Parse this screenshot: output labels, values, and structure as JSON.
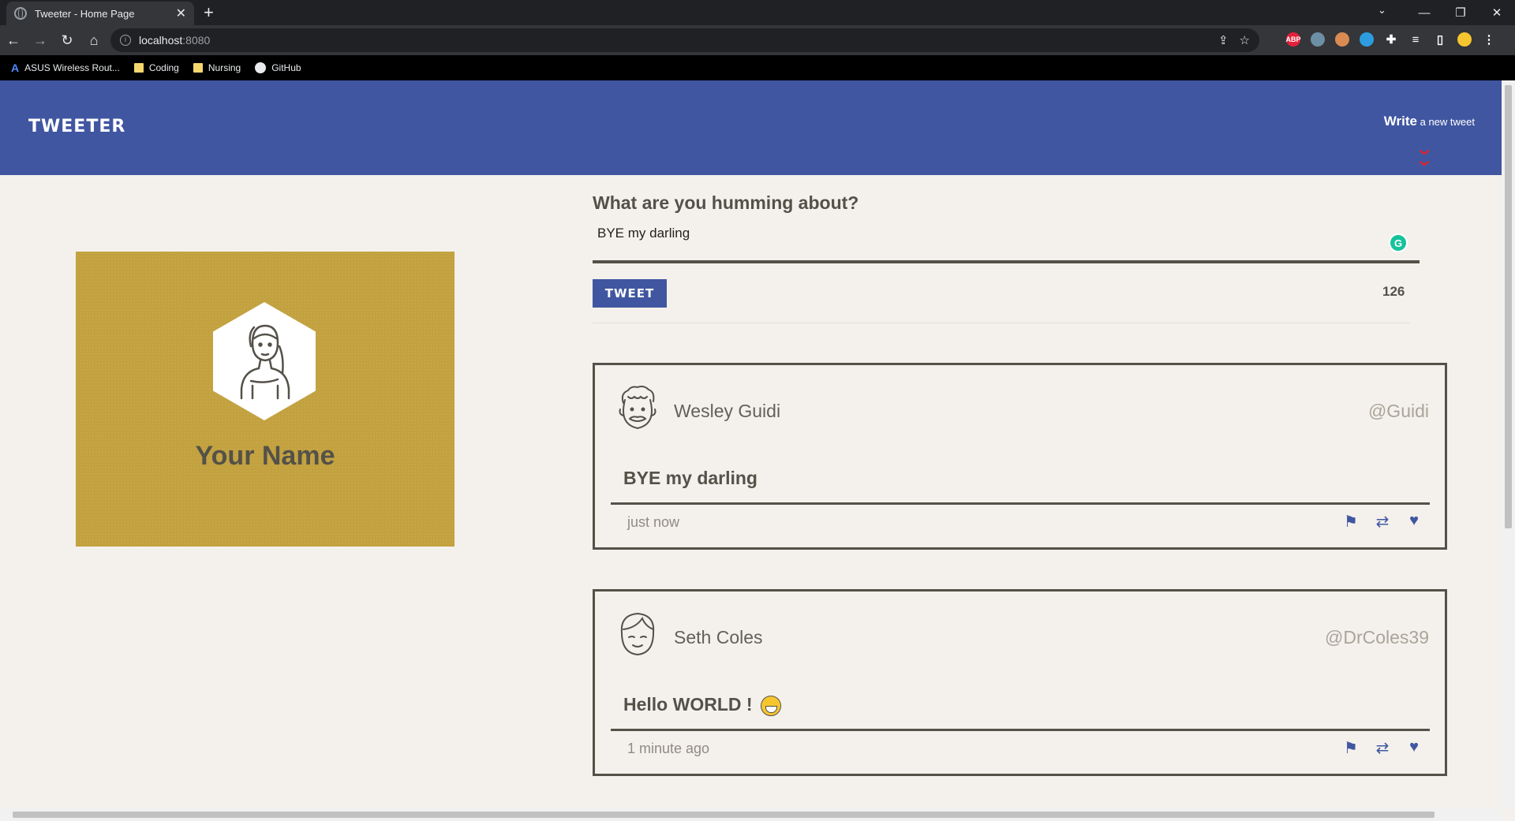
{
  "browser": {
    "tab_title": "Tweeter - Home Page",
    "tab_close": "✕",
    "new_tab": "+",
    "url_host": "localhost",
    "url_port": ":8080",
    "window_controls": [
      "⌄",
      "—",
      "❐",
      "✕"
    ],
    "bookmarks": [
      "ASUS Wireless Rout...",
      "Coding",
      "Nursing",
      "GitHub"
    ],
    "extensions": [
      {
        "name": "adblock-icon",
        "label": "ABP",
        "color": "#e3213c"
      },
      {
        "name": "globe-ext-icon",
        "label": "",
        "color": "#6d8fa6"
      },
      {
        "name": "eyes-ext-icon",
        "label": "",
        "color": "#d98b52"
      },
      {
        "name": "gem-ext-icon",
        "label": "",
        "color": "#2d9de0"
      }
    ]
  },
  "nav": {
    "brand": "TWEETER",
    "write_big": "Write",
    "write_small": " a new tweet"
  },
  "profile": {
    "name": "Your Name"
  },
  "composer": {
    "title": "What are you humming about?",
    "value": "BYE my darling",
    "button": "TWEET",
    "counter": "126"
  },
  "tweets": [
    {
      "name": "Wesley Guidi",
      "handle": "@Guidi",
      "body": "BYE my darling",
      "time": "just now"
    },
    {
      "name": "Seth Coles",
      "handle": "@DrColes39",
      "body": "Hello WORLD !",
      "time": "1 minute ago"
    }
  ],
  "colors": {
    "nav": "#4056a1",
    "accent": "#e0232e",
    "profile_bg": "#c2a13e",
    "text": "#545149"
  }
}
